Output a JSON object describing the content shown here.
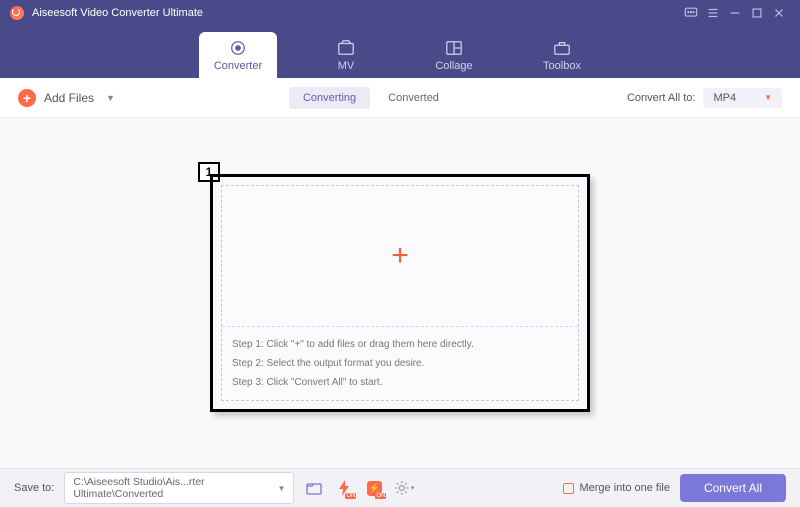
{
  "titlebar": {
    "title": "Aiseesoft Video Converter Ultimate"
  },
  "nav": {
    "converter": "Converter",
    "mv": "MV",
    "collage": "Collage",
    "toolbox": "Toolbox"
  },
  "toolbar": {
    "add_files": "Add Files",
    "converting": "Converting",
    "converted": "Converted",
    "convert_all_to": "Convert All to:",
    "format": "MP4"
  },
  "dropzone": {
    "badge": "1",
    "step1": "Step 1: Click \"+\" to add files or drag them here directly.",
    "step2": "Step 2: Select the output format you desire.",
    "step3": "Step 3: Click \"Convert All\" to start."
  },
  "footer": {
    "save_to": "Save to:",
    "path": "C:\\Aiseesoft Studio\\Ais...rter Ultimate\\Converted",
    "merge": "Merge into one file",
    "convert_all": "Convert All"
  }
}
